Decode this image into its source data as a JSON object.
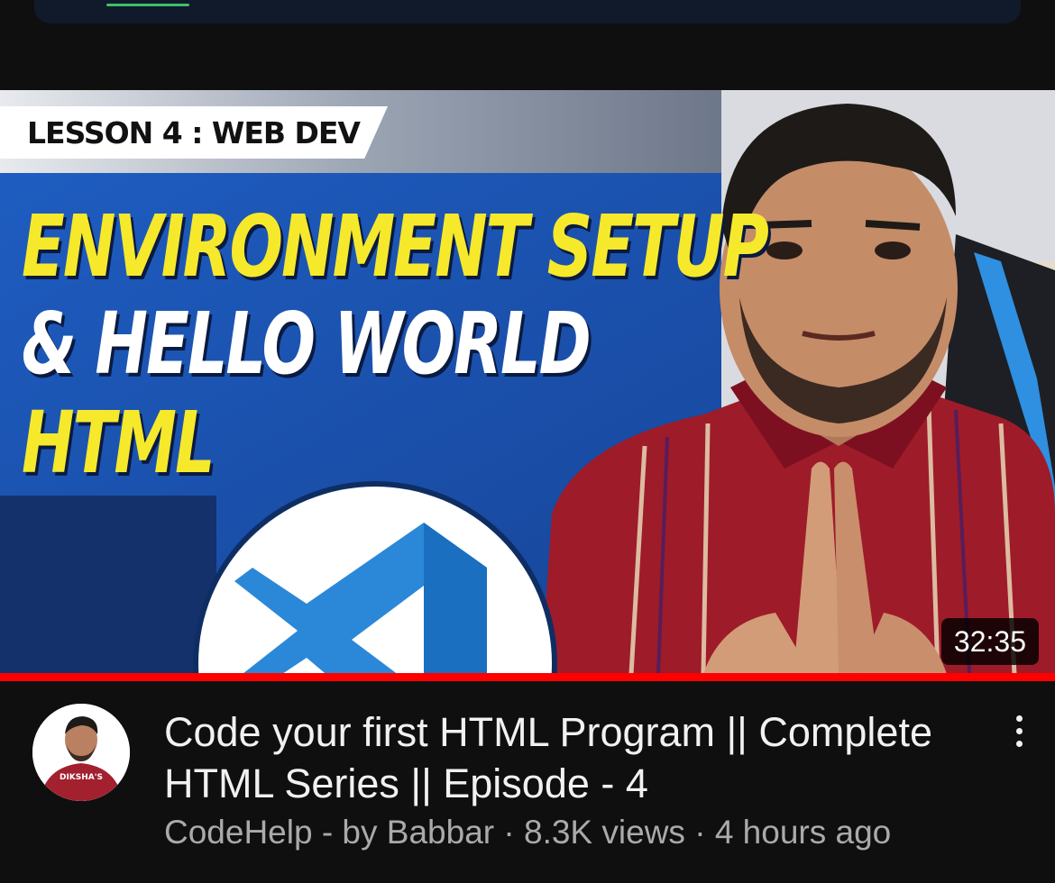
{
  "video": {
    "thumbnail": {
      "lesson_tag": "LESSON 4 : WEB DEV",
      "headline_line1": "ENVIRONMENT SETUP",
      "headline_line2": "& HELLO WORLD",
      "headline_line3": "HTML",
      "logo_icon": "vscode-logo-icon",
      "duration": "32:35",
      "watch_progress": 1.0,
      "avatar_shirt_text": "DIKSHA'S"
    },
    "title": "Code your first HTML Program || Complete HTML Series || Episode - 4",
    "channel": "CodeHelp - by Babbar",
    "views": "8.3K views",
    "age": "4 hours ago",
    "separator": " · ",
    "more_icon": "vertical-ellipsis-icon"
  },
  "colors": {
    "background": "#0f0f0f",
    "progress": "#ff0000",
    "title_text": "#f1f1f1",
    "meta_text": "#aaaaaa",
    "thumb_blue": "#1b4fa8",
    "thumb_yellow": "#f6e92b",
    "shirt_red": "#9e1b2a"
  }
}
